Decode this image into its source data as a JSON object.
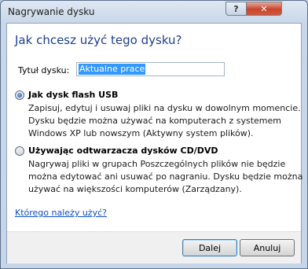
{
  "window": {
    "title": "Nagrywanie dysku",
    "help_glyph": "?",
    "close_glyph": "✕"
  },
  "heading": "Jak chcesz użyć tego dysku?",
  "disc_title": {
    "label": "Tytuł dysku:",
    "value": "Aktualne prace"
  },
  "options": [
    {
      "title": "Jak dysk flash USB",
      "checked": true,
      "lines": [
        "Zapisuj, edytuj i usuwaj pliki na dysku w dowolnym momencie.",
        "Dysku będzie można używać na komputerach z systemem",
        "Windows XP lub nowszym (Aktywny system plików)."
      ]
    },
    {
      "title": "Używając odtwarzacza dysków CD/DVD",
      "checked": false,
      "lines": [
        "Nagrywaj pliki w grupach Poszczególnych plików nie będzie",
        "można edytować ani usuwać po nagraniu. Dysku będzie można",
        "używać na większości komputerów (Zarządzany)."
      ]
    }
  ],
  "help_link": "Którego należy użyć?",
  "buttons": {
    "next": "Dalej",
    "cancel": "Anuluj"
  },
  "colors": {
    "heading": "#1f3f8a",
    "link": "#0b4fbf",
    "selection": "#3399ff"
  }
}
